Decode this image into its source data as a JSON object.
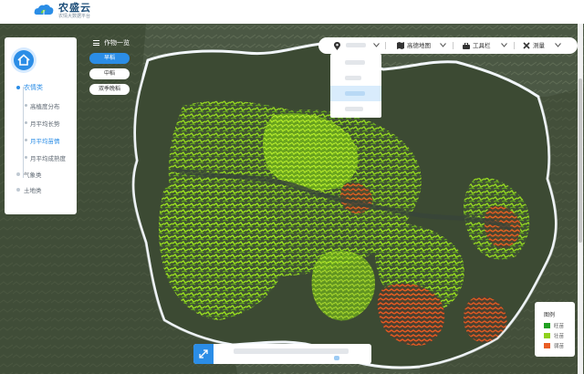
{
  "app": {
    "logo_title": "农盛云",
    "logo_subtitle": "农情大数据平台"
  },
  "sidebar": {
    "categories": [
      {
        "label": "农情类",
        "active": true,
        "items": [
          {
            "label": "高植度分布",
            "active": false
          },
          {
            "label": "月平均长势",
            "active": false
          },
          {
            "label": "月平均苗情",
            "active": true
          },
          {
            "label": "月平均成熟度",
            "active": false
          }
        ]
      },
      {
        "label": "气象类",
        "active": false,
        "items": []
      },
      {
        "label": "土地类",
        "active": false,
        "items": []
      }
    ]
  },
  "crop_panel": {
    "title": "作物一览",
    "buttons": [
      {
        "label": "早稻",
        "active": true
      },
      {
        "label": "中稻",
        "active": false
      },
      {
        "label": "双季晚稻",
        "active": false
      }
    ]
  },
  "toolbar": {
    "region_label": "",
    "basemap_label": "高德地图",
    "tools_label": "工具栏",
    "measure_label": "测量"
  },
  "region_dropdown": {
    "selected_index": 2,
    "item_count": 4
  },
  "legend": {
    "title": "图例",
    "items": [
      {
        "label": "旺苗",
        "color": "#22a022"
      },
      {
        "label": "壮苗",
        "color": "#8fd11d"
      },
      {
        "label": "弱苗",
        "color": "#e95e25"
      }
    ]
  },
  "bottom_bar": {
    "icon": "expand-icon",
    "text": ""
  },
  "colors": {
    "accent": "#2b8de6",
    "vigorous": "#22a022",
    "strong": "#8fd11d",
    "weak": "#e95e25",
    "terrain": "#4b5a46"
  }
}
